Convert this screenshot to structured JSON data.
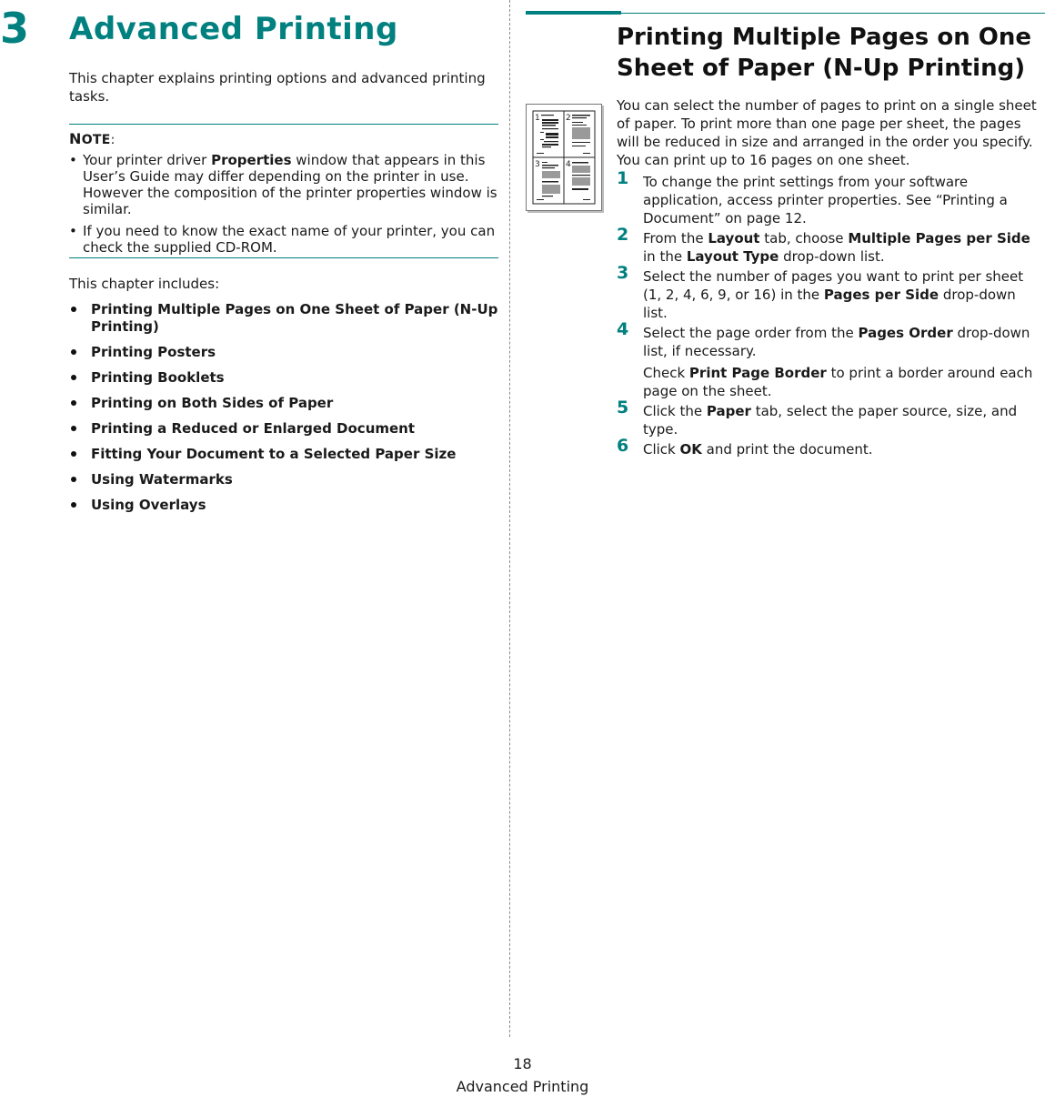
{
  "chapter": {
    "number": "3",
    "title": "Advanced Printing",
    "intro": "This chapter explains printing options and advanced printing tasks."
  },
  "note": {
    "label_first": "N",
    "label_rest": "OTE",
    "label_colon": ":",
    "items": [
      {
        "pre": "Your printer driver ",
        "bold": "Properties",
        "post": " window that appears in this User’s Guide may differ depending on the printer in use. However the composition of the printer properties window is similar."
      },
      {
        "pre": "If you need to know the exact name of your printer, you can check the supplied CD-ROM.",
        "bold": "",
        "post": ""
      }
    ]
  },
  "includes": {
    "heading": "This chapter includes:",
    "items": [
      "Printing Multiple Pages on One Sheet of Paper (N-Up Printing)",
      "Printing Posters",
      "Printing Booklets",
      "Printing on Both Sides of Paper",
      "Printing a Reduced or Enlarged Document",
      "Fitting Your Document to a Selected Paper Size",
      "Using Watermarks",
      "Using Overlays"
    ]
  },
  "section": {
    "title": "Printing Multiple Pages on One Sheet of Paper (N-Up Printing)",
    "thumbnail": {
      "icon": "n-up-pages-illustration",
      "page_labels": [
        "1",
        "2",
        "3",
        "4"
      ]
    },
    "intro": "You can select the number of pages to print on a single sheet of paper. To print more than one page per sheet, the pages will be reduced in size and arranged in the order you specify. You can print up to 16 pages on one sheet.",
    "steps": [
      {
        "num": "1",
        "parts": [
          {
            "t": "To change the print settings from your software application, access printer properties. See “Printing a Document” on page 12.",
            "b": false
          }
        ]
      },
      {
        "num": "2",
        "parts": [
          {
            "t": "From the ",
            "b": false
          },
          {
            "t": "Layout",
            "b": true
          },
          {
            "t": " tab, choose ",
            "b": false
          },
          {
            "t": "Multiple Pages per Side",
            "b": true
          },
          {
            "t": " in the ",
            "b": false
          },
          {
            "t": "Layout Type",
            "b": true
          },
          {
            "t": " drop-down list.",
            "b": false
          }
        ]
      },
      {
        "num": "3",
        "parts": [
          {
            "t": "Select the number of pages you want to print per sheet (1, 2, 4, 6, 9, or 16) in the ",
            "b": false
          },
          {
            "t": "Pages per Side",
            "b": true
          },
          {
            "t": " drop-down list.",
            "b": false
          }
        ]
      },
      {
        "num": "4",
        "parts": [
          {
            "t": "Select the page order from the ",
            "b": false
          },
          {
            "t": "Pages Order",
            "b": true
          },
          {
            "t": " drop-down list, if necessary.",
            "b": false
          }
        ],
        "sub": [
          {
            "t": "Check ",
            "b": false
          },
          {
            "t": "Print Page Border",
            "b": true
          },
          {
            "t": " to print a border around each page on the sheet.",
            "b": false
          }
        ]
      },
      {
        "num": "5",
        "parts": [
          {
            "t": "Click the ",
            "b": false
          },
          {
            "t": "Paper",
            "b": true
          },
          {
            "t": " tab, select the paper source, size, and type.",
            "b": false
          }
        ]
      },
      {
        "num": "6",
        "parts": [
          {
            "t": "Click ",
            "b": false
          },
          {
            "t": "OK",
            "b": true
          },
          {
            "t": " and print the document.",
            "b": false
          }
        ]
      }
    ]
  },
  "footer": {
    "page_number": "18",
    "chapter_name": "Advanced Printing"
  },
  "colors": {
    "accent": "#00807f",
    "text": "#1a1a1a"
  }
}
